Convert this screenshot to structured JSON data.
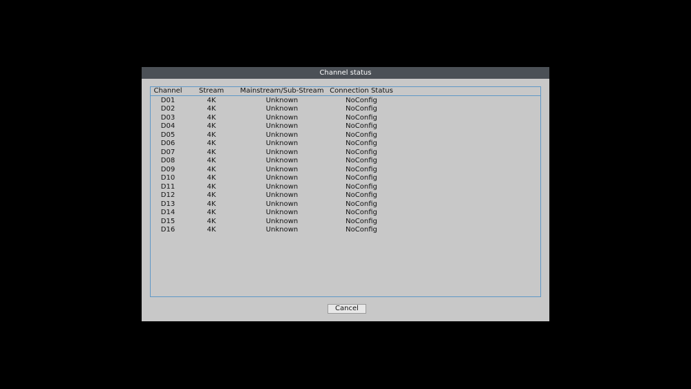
{
  "dialog": {
    "title": "Channel status",
    "cancel_label": "Cancel"
  },
  "table": {
    "columns": [
      "Channel",
      "Stream",
      "Mainstream/Sub-Stream",
      "Connection Status"
    ],
    "rows": [
      {
        "channel": "D01",
        "stream": "4K",
        "mss": "Unknown",
        "conn": "NoConfig"
      },
      {
        "channel": "D02",
        "stream": "4K",
        "mss": "Unknown",
        "conn": "NoConfig"
      },
      {
        "channel": "D03",
        "stream": "4K",
        "mss": "Unknown",
        "conn": "NoConfig"
      },
      {
        "channel": "D04",
        "stream": "4K",
        "mss": "Unknown",
        "conn": "NoConfig"
      },
      {
        "channel": "D05",
        "stream": "4K",
        "mss": "Unknown",
        "conn": "NoConfig"
      },
      {
        "channel": "D06",
        "stream": "4K",
        "mss": "Unknown",
        "conn": "NoConfig"
      },
      {
        "channel": "D07",
        "stream": "4K",
        "mss": "Unknown",
        "conn": "NoConfig"
      },
      {
        "channel": "D08",
        "stream": "4K",
        "mss": "Unknown",
        "conn": "NoConfig"
      },
      {
        "channel": "D09",
        "stream": "4K",
        "mss": "Unknown",
        "conn": "NoConfig"
      },
      {
        "channel": "D10",
        "stream": "4K",
        "mss": "Unknown",
        "conn": "NoConfig"
      },
      {
        "channel": "D11",
        "stream": "4K",
        "mss": "Unknown",
        "conn": "NoConfig"
      },
      {
        "channel": "D12",
        "stream": "4K",
        "mss": "Unknown",
        "conn": "NoConfig"
      },
      {
        "channel": "D13",
        "stream": "4K",
        "mss": "Unknown",
        "conn": "NoConfig"
      },
      {
        "channel": "D14",
        "stream": "4K",
        "mss": "Unknown",
        "conn": "NoConfig"
      },
      {
        "channel": "D15",
        "stream": "4K",
        "mss": "Unknown",
        "conn": "NoConfig"
      },
      {
        "channel": "D16",
        "stream": "4K",
        "mss": "Unknown",
        "conn": "NoConfig"
      }
    ]
  },
  "colors": {
    "background": "#000000",
    "dialog_body": "#c8c8c8",
    "titlebar": "#4b5056",
    "table_border": "#5d97c6"
  }
}
